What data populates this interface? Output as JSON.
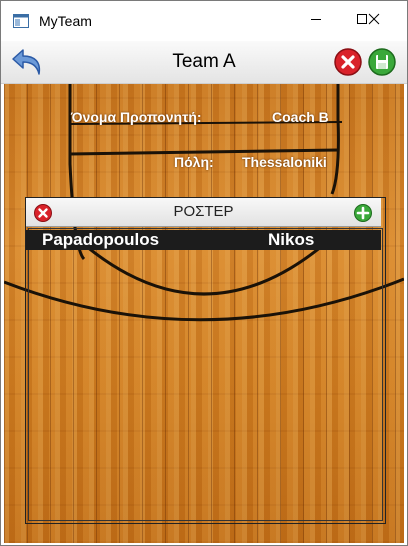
{
  "window": {
    "title": "MyTeam",
    "icon": "app-window-icon"
  },
  "window_controls": {
    "minimize": "minimize-icon",
    "maximize": "maximize-icon",
    "close": "close-icon"
  },
  "toolbar": {
    "title": "Team A",
    "back_icon": "back-arrow-icon",
    "delete_icon": "red-x-icon",
    "save_icon": "floppy-disk-icon"
  },
  "team_info": {
    "coach_label": "Όνομα Προπονητή:",
    "coach_value": "Coach B",
    "city_label": "Πόλη:",
    "city_value": "Thessaloniki"
  },
  "roster": {
    "title": "ΡΟΣΤΕΡ",
    "remove_icon": "red-x-icon",
    "add_icon": "green-plus-icon",
    "players": [
      {
        "surname": "Papadopoulos",
        "name": "Nikos"
      }
    ]
  },
  "colors": {
    "court": "#d08226",
    "row_bg": "#1c1c1c",
    "accent_red": "#d9222a",
    "accent_green": "#3aa83a"
  }
}
